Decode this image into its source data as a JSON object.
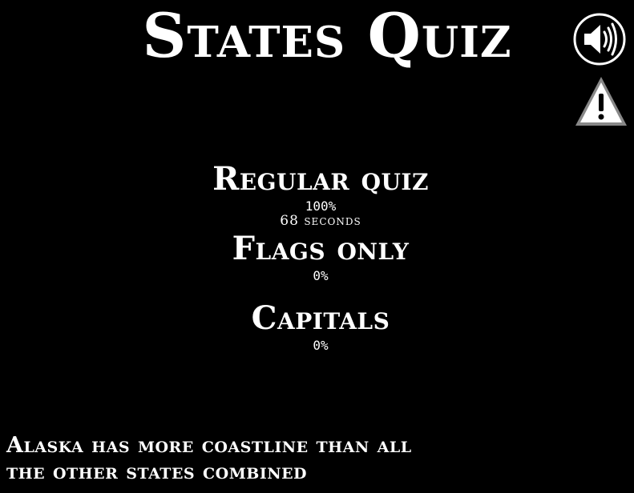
{
  "title": "States Quiz",
  "controls": {
    "sound_icon": "speaker-icon",
    "warning_icon": "warning-icon"
  },
  "modes": [
    {
      "label": "Regular quiz",
      "score": "100%",
      "time": "68 seconds"
    },
    {
      "label": "Flags only",
      "score": "0%"
    },
    {
      "label": "Capitals",
      "score": "0%"
    }
  ],
  "fact": {
    "line1": "Alaska has more coastline than all",
    "line2": "the other states combined"
  },
  "colors": {
    "background": "#000000",
    "text": "#ffffff",
    "warning_fill": "#ffffff",
    "warning_border": "#888888"
  }
}
